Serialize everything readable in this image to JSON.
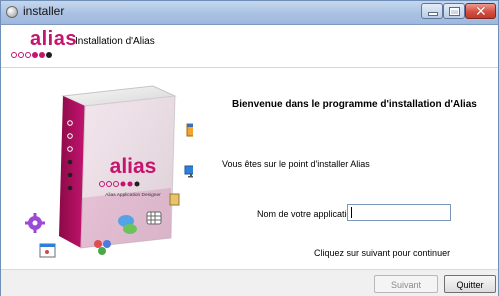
{
  "window": {
    "title": "installer"
  },
  "header": {
    "logo_text": "alias",
    "title": "Installation d'Alias"
  },
  "illustration": {
    "box_logo_text": "alias",
    "box_subtitle": "Alias Application Designer",
    "brand_color": "#c4146f",
    "icons": [
      "calendar-icon",
      "monitor-icon",
      "document-icon",
      "grid-icon",
      "chat-icon",
      "users-icon",
      "gear-icon",
      "window-icon"
    ]
  },
  "main": {
    "heading": "Bienvenue dans le programme d'installation d'Alias",
    "intro": "Vous êtes sur le point d'installer Alias",
    "app_name_label": "Nom de votre application",
    "app_name_value": "",
    "continue_hint": "Cliquez sur suivant pour continuer"
  },
  "footer": {
    "next_label": "Suivant",
    "quit_label": "Quitter"
  }
}
